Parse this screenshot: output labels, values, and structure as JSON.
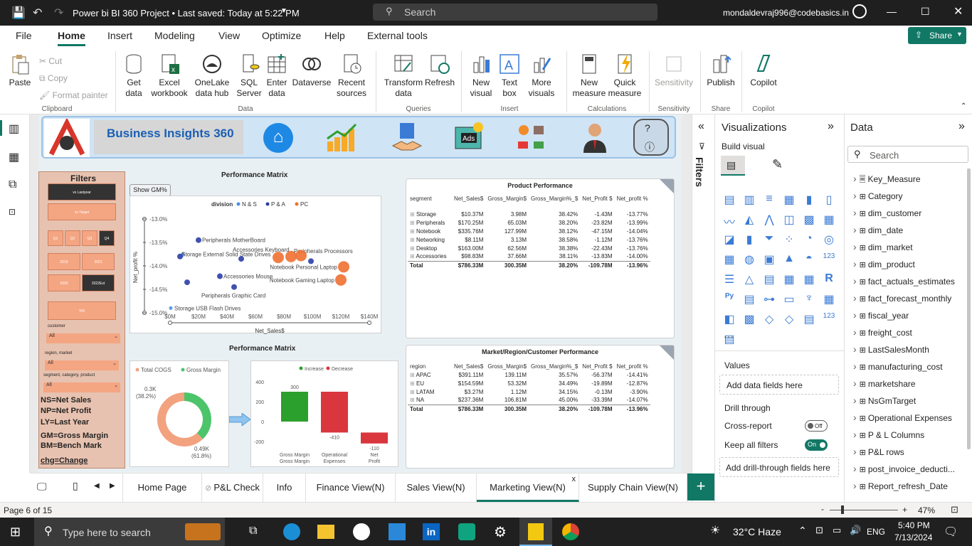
{
  "window": {
    "title": "Power bi BI 360 Project • Last saved: Today at 5:22 PM",
    "search_placeholder": "Search",
    "user": "mondaldevraj996@codebasics.in"
  },
  "menu": [
    "File",
    "Home",
    "Insert",
    "Modeling",
    "View",
    "Optimize",
    "Help",
    "External tools"
  ],
  "share_label": "Share",
  "ribbon": {
    "paste": "Paste",
    "cut": "Cut",
    "copy": "Copy",
    "format_painter": "Format painter",
    "clipboard": "Clipboard",
    "get_data": "Get data",
    "excel": "Excel workbook",
    "onelake": "OneLake data hub",
    "sql": "SQL Server",
    "enter_data": "Enter data",
    "dataverse": "Dataverse",
    "recent": "Recent sources",
    "data": "Data",
    "transform": "Transform data",
    "refresh": "Refresh",
    "queries": "Queries",
    "new_visual": "New visual",
    "text_box": "Text box",
    "more_visuals": "More visuals",
    "insert": "Insert",
    "new_measure": "New measure",
    "quick_measure": "Quick measure",
    "calculations": "Calculations",
    "sensitivity": "Sensitivity",
    "sensitivity_grp": "Sensitivity",
    "publish": "Publish",
    "share_grp": "Share",
    "copilot": "Copilot",
    "copilot_grp": "Copilot"
  },
  "report": {
    "header_title": "Business Insights 360",
    "filters": {
      "title": "Filters",
      "vs_ly": "vs Lastyear",
      "vs_target": "vs Target",
      "quarters": [
        "Q1",
        "Q2",
        "Q3",
        "Q4"
      ],
      "years": [
        "2019",
        "2021",
        "2020",
        "2022Est"
      ],
      "ytd": "YtD",
      "customer": "customer",
      "all": "All",
      "region_market": "region, market",
      "seg_cat_prod": "segment, category, product"
    },
    "legend_defs": [
      "NS=Net Sales",
      "NP=Net Profit",
      "LY=Last Year",
      "GM=Gross Margin",
      "BM=Bench Mark",
      "chg=Change"
    ],
    "show_gm": "Show GM%",
    "scatter_title": "Performance Matrix",
    "donut_title": "Performance Matrix",
    "product_perf": {
      "title": "Product Performance",
      "headers": [
        "segment",
        "Net_Sales$",
        "Gross_Margin$",
        "Gross_Margin%_$",
        "Net_Profit $",
        "Net_profit %"
      ],
      "rows": [
        [
          "Storage",
          "$10.37M",
          "3.98M",
          "38.42%",
          "-1.43M",
          "-13.77%"
        ],
        [
          "Peripherals",
          "$170.25M",
          "65.03M",
          "38.20%",
          "-23.82M",
          "-13.99%"
        ],
        [
          "Notebook",
          "$335.76M",
          "127.99M",
          "38.12%",
          "-47.15M",
          "-14.04%"
        ],
        [
          "Networking",
          "$8.11M",
          "3.13M",
          "38.58%",
          "-1.12M",
          "-13.76%"
        ],
        [
          "Desktop",
          "$163.00M",
          "62.56M",
          "38.38%",
          "-22.43M",
          "-13.76%"
        ],
        [
          "Accessories",
          "$98.83M",
          "37.66M",
          "38.11%",
          "-13.83M",
          "-14.00%"
        ]
      ],
      "total": [
        "Total",
        "$786.33M",
        "300.35M",
        "38.20%",
        "-109.78M",
        "-13.96%"
      ]
    },
    "market_perf": {
      "title": "Market/Region/Customer Performance",
      "headers": [
        "region",
        "Net_Sales$",
        "Gross_Margin$",
        "Gross_Margin%_$",
        "Net_Profit $",
        "Net_profit %"
      ],
      "rows": [
        [
          "APAC",
          "$391.11M",
          "139.11M",
          "35.57%",
          "-56.37M",
          "-14.41%"
        ],
        [
          "EU",
          "$154.59M",
          "53.32M",
          "34.49%",
          "-19.89M",
          "-12.87%"
        ],
        [
          "LATAM",
          "$3.27M",
          "1.12M",
          "34.15%",
          "-0.13M",
          "-3.90%"
        ],
        [
          "NA",
          "$237.36M",
          "106.81M",
          "45.00%",
          "-33.39M",
          "-14.07%"
        ]
      ],
      "total": [
        "Total",
        "$786.33M",
        "300.35M",
        "38.20%",
        "-109.78M",
        "-13.96%"
      ]
    }
  },
  "chart_data": [
    {
      "type": "scatter",
      "title": "Performance Matrix",
      "xlabel": "Net_Sales$",
      "ylabel": "Net_profit %",
      "legend_title": "division",
      "legend": [
        "N & S",
        "P & A",
        "PC"
      ],
      "xticks": [
        "$0M",
        "$20M",
        "$40M",
        "$60M",
        "$80M",
        "$100M",
        "$120M",
        "$140M"
      ],
      "yticks": [
        "-13.0%",
        "-13.5%",
        "-14.0%",
        "-14.5%",
        "-15.0%"
      ],
      "xlim": [
        0,
        140
      ],
      "ylim": [
        -15.0,
        -13.0
      ],
      "series": [
        {
          "name": "N & S",
          "color": "#4a90e2",
          "points": [
            {
              "label": "Storage External Solid State Drives",
              "x": 9,
              "y": -13.75
            },
            {
              "label": "Storage USB Flash Drives",
              "x": 0.5,
              "y": -14.9
            }
          ]
        },
        {
          "name": "P & A",
          "color": "#2c3ea8",
          "points": [
            {
              "label": "Peripherals MotherBoard",
              "x": 20,
              "y": -13.45
            },
            {
              "label": "Accessories Keyboard",
              "x": 50,
              "y": -13.85
            },
            {
              "label": "Accessories Mouse",
              "x": 35,
              "y": -14.22
            },
            {
              "label": "Peripherals Graphic Card",
              "x": 45,
              "y": -14.45
            },
            {
              "label": "",
              "x": 12,
              "y": -14.35
            },
            {
              "label": "",
              "x": 7,
              "y": -13.8
            },
            {
              "label": "",
              "x": 99,
              "y": -13.9
            }
          ]
        },
        {
          "name": "PC",
          "color": "#f07030",
          "points": [
            {
              "label": "Peripherals Processors",
              "x": 85,
              "y": -13.8
            },
            {
              "label": "",
              "x": 76,
              "y": -13.82
            },
            {
              "label": "",
              "x": 92,
              "y": -13.78
            },
            {
              "label": "Notebook Personal Laptop",
              "x": 122,
              "y": -14.02
            },
            {
              "label": "Notebook Gaming Laptop",
              "x": 120,
              "y": -14.3
            }
          ]
        }
      ]
    },
    {
      "type": "pie",
      "legend": [
        "Total COGS",
        "Gross Margin"
      ],
      "slices": [
        {
          "name": "Gross Margin",
          "value": 0.3,
          "label": "0.3K (38.2%)",
          "color": "#4cc46a"
        },
        {
          "name": "Total COGS",
          "value": 0.49,
          "label": "0.49K (61.8%)",
          "color": "#f3a280"
        }
      ]
    },
    {
      "type": "bar",
      "subtype": "waterfall",
      "legend": [
        "Increase",
        "Decrease"
      ],
      "categories": [
        "Gross Margin",
        "Operational Expenses",
        "Net Profit"
      ],
      "values": [
        300,
        -410,
        -110
      ],
      "yticks": [
        "400",
        "200",
        "0",
        "-200"
      ],
      "ylim": [
        -250,
        450
      ]
    }
  ],
  "viz_pane": {
    "title": "Visualizations",
    "build_visual": "Build visual",
    "values": "Values",
    "add_fields": "Add data fields here",
    "drill_through": "Drill through",
    "cross_report": "Cross-report",
    "cross_off": "Off",
    "keep_filters": "Keep all filters",
    "keep_on": "On",
    "add_drill": "Add drill-through fields here"
  },
  "filters_pane": {
    "label": "Filters"
  },
  "data_pane": {
    "title": "Data",
    "search": "Search",
    "tables": [
      "Key_Measure",
      "Category",
      "dim_customer",
      "dim_date",
      "dim_market",
      "dim_product",
      "fact_actuals_estimates",
      "fact_forecast_monthly",
      "fiscal_year",
      "freight_cost",
      "LastSalesMonth",
      "manufacturing_cost",
      "marketshare",
      "NsGmTarget",
      "Operational Expenses",
      "P & L Columns",
      "P&L rows",
      "post_invoice_deducti...",
      "Report_refresh_Date"
    ]
  },
  "tabs": [
    "Home Page",
    "P&L Check",
    "Info",
    "Finance View(N)",
    "Sales View(N)",
    "Marketing View(N)",
    "Supply Chain View(N)"
  ],
  "status": {
    "page": "Page 6 of 15",
    "zoom": "47%"
  },
  "taskbar": {
    "search": "Type here to search",
    "weather": "32°C  Haze",
    "lang": "ENG",
    "time": "5:40 PM",
    "date": "7/13/2024"
  }
}
